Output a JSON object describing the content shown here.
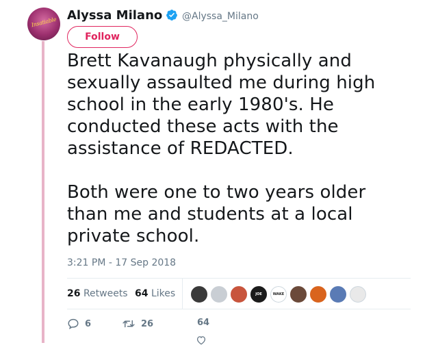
{
  "user": {
    "display_name": "Alyssa Milano",
    "handle": "@Alyssa_Milano",
    "avatar_text": "Insatiable",
    "verified_icon": "verified-badge-icon"
  },
  "follow_button": {
    "label": "Follow"
  },
  "tweet": {
    "paragraph_1": "Brett Kavanaugh physically and sexually assaulted me during high school in the early 1980's. He conducted these acts with the assistance of REDACTED.",
    "paragraph_2": "Both were one to two years older than me and students at a local private school.",
    "timestamp": "3:21 PM - 17 Sep 2018"
  },
  "stats": {
    "retweets_count": "26",
    "retweets_label": "Retweets",
    "likes_count": "64",
    "likes_label": "Likes"
  },
  "likers": [
    {
      "name": "liker-1",
      "color": "#3a3a3a",
      "text": ""
    },
    {
      "name": "liker-2",
      "color": "#c9ced4",
      "text": ""
    },
    {
      "name": "liker-3",
      "color": "#c8553d",
      "text": ""
    },
    {
      "name": "liker-4",
      "color": "#1b1b1b",
      "text": "JOE"
    },
    {
      "name": "liker-5",
      "color": "#ffffff",
      "text": "WAKE UP"
    },
    {
      "name": "liker-6",
      "color": "#6b4a3a",
      "text": ""
    },
    {
      "name": "liker-7",
      "color": "#d9641e",
      "text": ""
    },
    {
      "name": "liker-8",
      "color": "#5a7bb5",
      "text": ""
    },
    {
      "name": "liker-9",
      "color": "#e9e9e9",
      "text": ""
    }
  ],
  "actions": {
    "reply_count": "6",
    "retweet_count": "26",
    "like_count": "64"
  },
  "colors": {
    "accent": "#e0245e",
    "verified": "#1da1f2",
    "thread_line": "#e8b4c8",
    "muted": "#657786"
  }
}
